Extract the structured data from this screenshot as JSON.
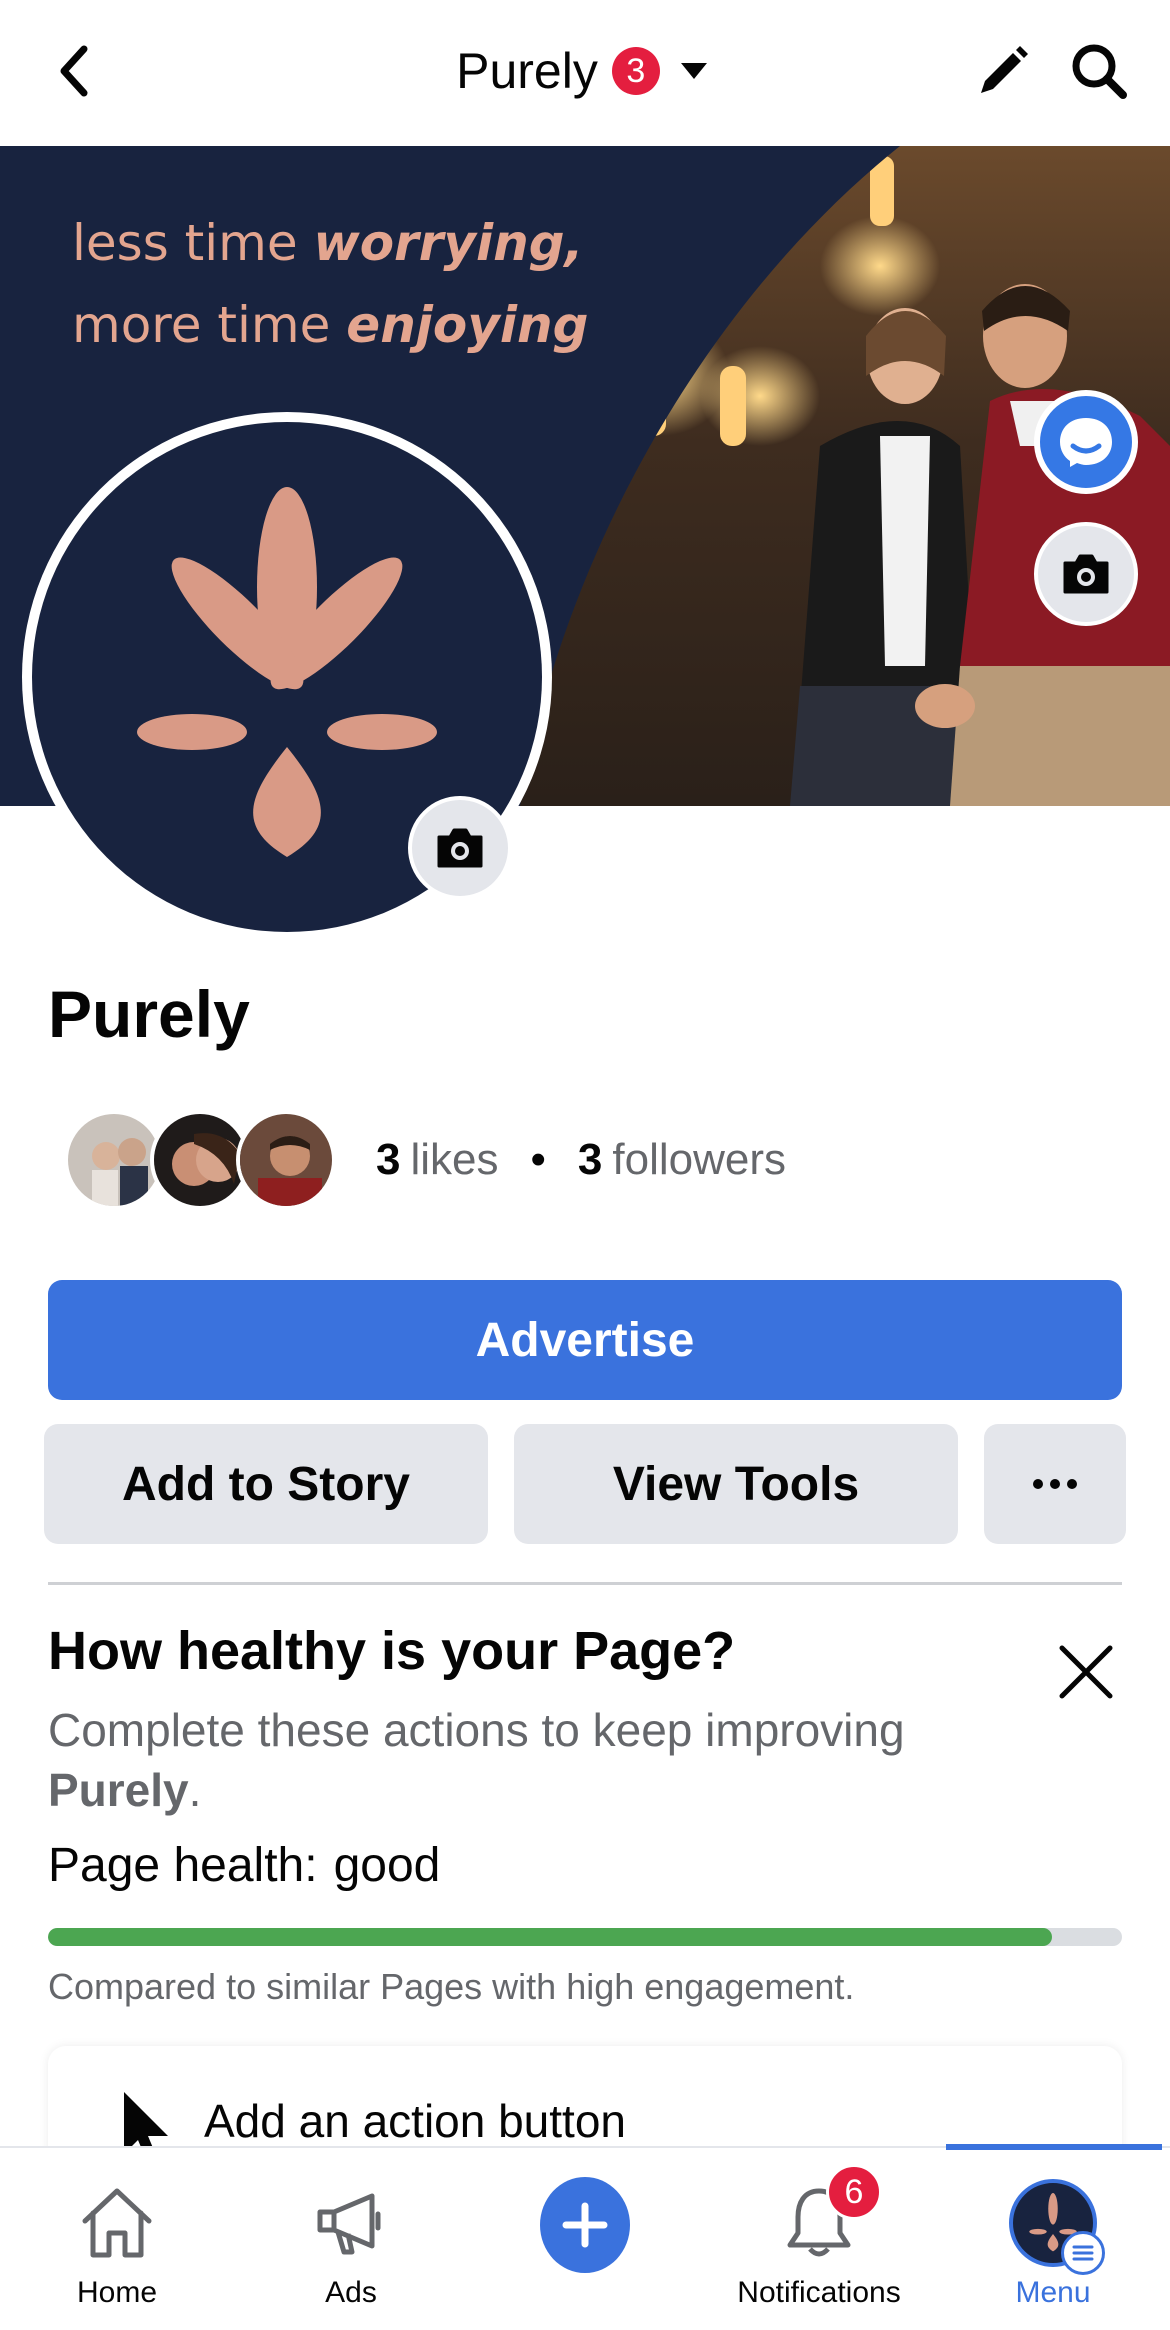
{
  "header": {
    "title": "Purely",
    "badge_count": "3"
  },
  "cover": {
    "tagline_line1_plain": "less time ",
    "tagline_line1_bold": "worrying,",
    "tagline_line2_plain": "more time ",
    "tagline_line2_bold": "enjoying"
  },
  "page": {
    "name": "Purely",
    "likes_count": "3",
    "likes_label": "likes",
    "followers_count": "3",
    "followers_label": "followers"
  },
  "actions": {
    "advertise": "Advertise",
    "add_to_story": "Add to Story",
    "view_tools": "View Tools",
    "more": "···"
  },
  "health": {
    "title": "How healthy is your Page?",
    "subtitle": "Complete these actions to keep improving",
    "subtitle_page": "Purely",
    "subtitle_end": ".",
    "label": "Page health:",
    "status": "good",
    "progress_fraction": 0.935,
    "note": "Compared to similar Pages with high engagement."
  },
  "action_card": {
    "label": "Add an action button"
  },
  "bottom_nav": {
    "items": [
      {
        "label": "Home",
        "icon": "home-icon"
      },
      {
        "label": "Ads",
        "icon": "megaphone-icon"
      },
      {
        "label": "",
        "icon": "plus-icon"
      },
      {
        "label": "Notifications",
        "icon": "bell-icon",
        "badge": "6"
      },
      {
        "label": "Menu",
        "icon": "menu-avatar-icon",
        "active": true
      }
    ]
  },
  "colors": {
    "brand_blue": "#3a72dd",
    "navy": "#18233f",
    "peach": "#e3a58f",
    "health_green": "#4ca651",
    "badge_red": "#e41e3f"
  }
}
